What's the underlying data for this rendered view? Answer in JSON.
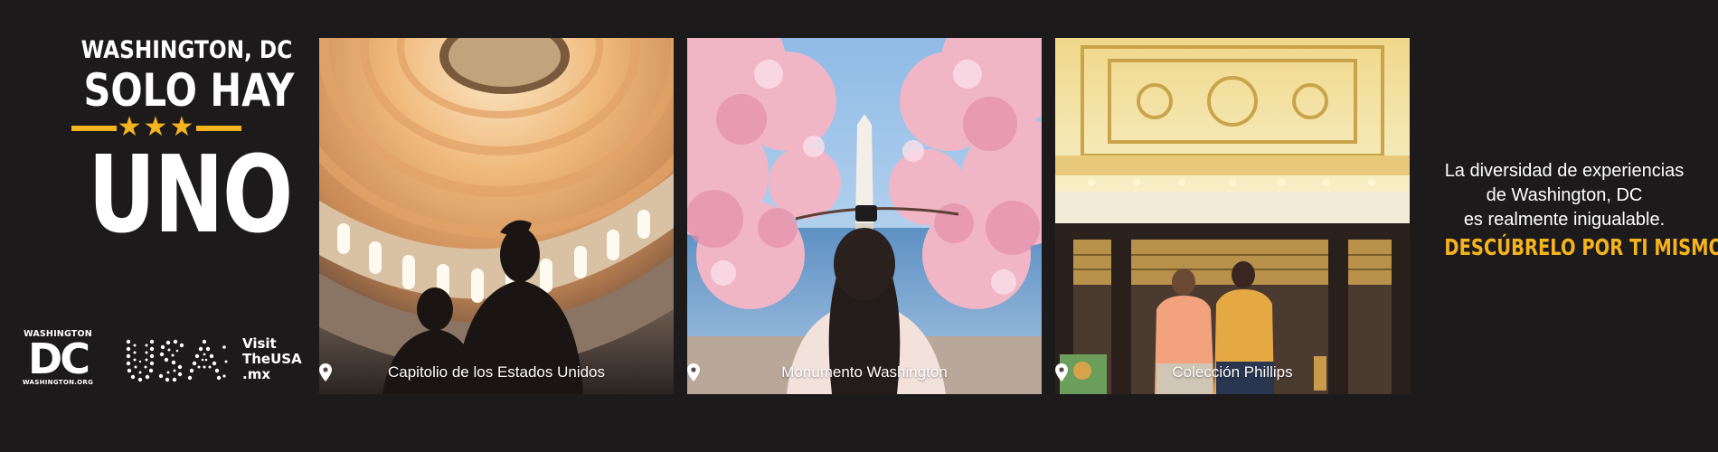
{
  "headline": {
    "city": "WASHINGTON, DC",
    "solo": "SOLO HAY",
    "stars": "★★★",
    "uno": "UNO"
  },
  "logos": {
    "dc": {
      "top": "WASHINGTON",
      "main": "DC",
      "bottom": "WASHINGTON.ORG"
    },
    "usa": {
      "visit": "Visit",
      "brand": "TheUSA",
      "tld": ".mx"
    }
  },
  "cards": [
    {
      "caption": "Capitolio de los Estados Unidos",
      "icon": "location-pin-icon"
    },
    {
      "caption": "Monumento Washington",
      "icon": "location-pin-icon"
    },
    {
      "caption": "Colección Phillips",
      "icon": "location-pin-icon"
    }
  ],
  "copy": {
    "line1": "La diversidad de experiencias",
    "line2": "de Washington, DC",
    "line3": "es realmente inigualable.",
    "cta": "DESCÚBRELO POR TI MISMO."
  },
  "colors": {
    "background": "#1c1a1b",
    "accent": "#f5b31e",
    "text": "#ffffff"
  }
}
